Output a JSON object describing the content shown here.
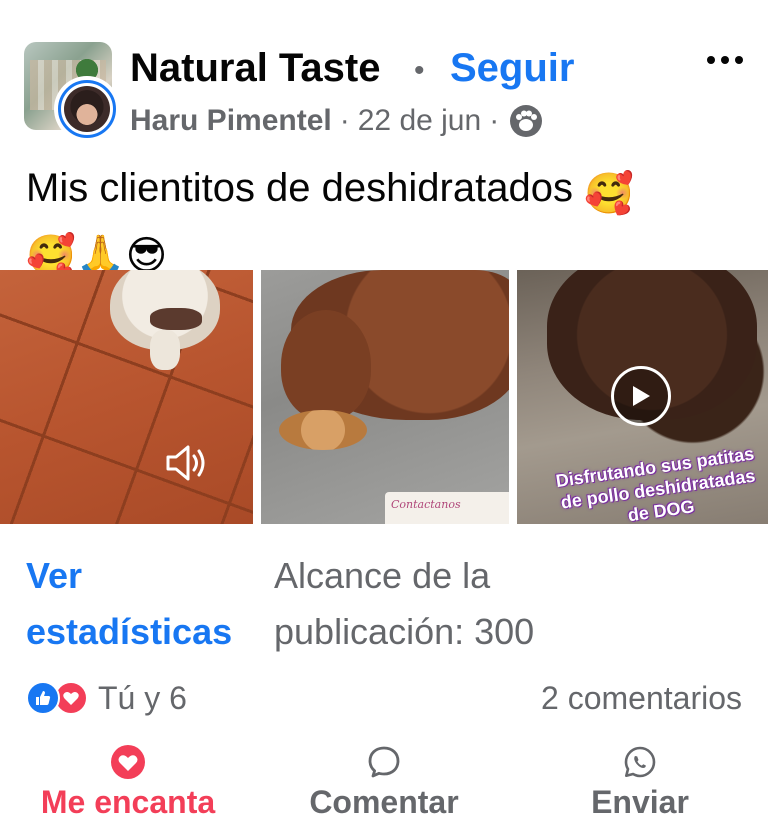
{
  "header": {
    "page_name": "Natural Taste",
    "separator": "•",
    "follow_label": "Seguir",
    "author": "Haru Pimentel",
    "meta_sep_1": "·",
    "date": "22 de jun",
    "meta_sep_2": "·",
    "audience_icon": "friends-paw-icon",
    "more_icon": "more-options-icon"
  },
  "post": {
    "text_main": "Mis clientitos de deshidratados ",
    "emoji_1": "🥰",
    "emoji_2": "🥰",
    "emoji_3": "🙏",
    "emoji_4": "😎"
  },
  "media": {
    "tile_2_label": "Contactanos",
    "tile_3_overlay": "Disfrutando sus patitas de pollo deshidratadas de DOG",
    "sound_icon": "sound-icon",
    "play_icon": "play-icon"
  },
  "insights": {
    "link_label": "Ver\nestadísticas",
    "reach_label": "Alcance de la\npublicación: 300"
  },
  "reactions": {
    "summary": "Tú y 6",
    "comments": "2 comentarios"
  },
  "actions": {
    "love_label": "Me encanta",
    "comment_label": "Comentar",
    "send_label": "Enviar"
  },
  "colors": {
    "accent": "#1877f2",
    "love": "#f33e58",
    "secondary_text": "#65676b"
  }
}
